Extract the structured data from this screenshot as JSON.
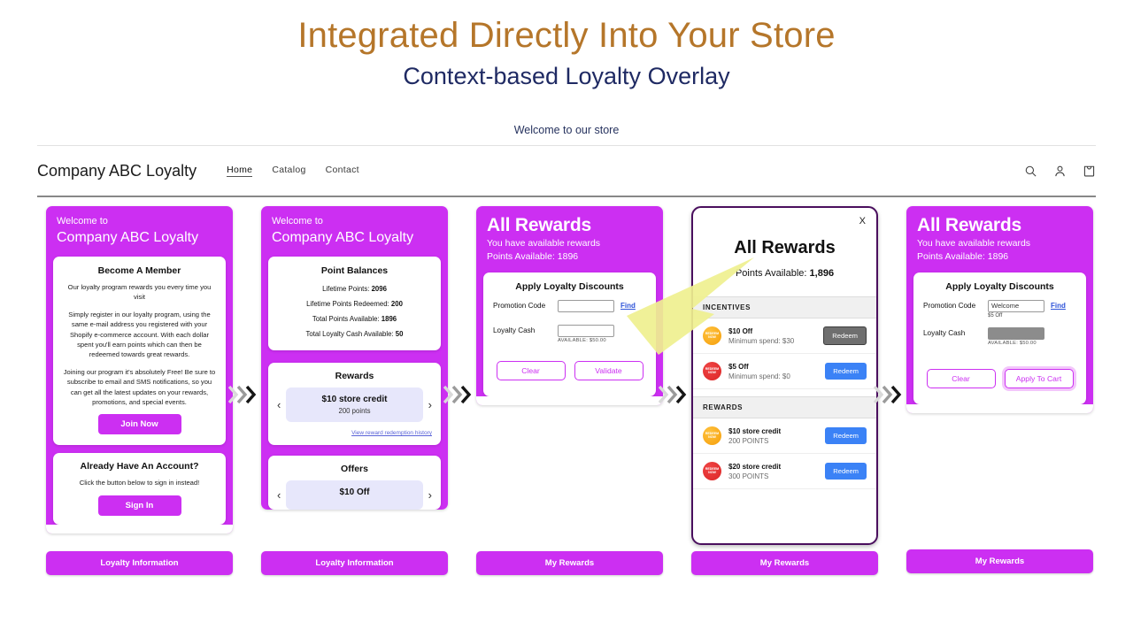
{
  "hero": {
    "title": "Integrated Directly Into Your Store",
    "subtitle": "Context-based Loyalty Overlay",
    "title_color": "#b5762a",
    "subtitle_color": "#1f2a63"
  },
  "store": {
    "announcement": "Welcome to our store",
    "name": "Company ABC Loyalty",
    "nav": [
      {
        "label": "Home",
        "active": true
      },
      {
        "label": "Catalog",
        "active": false
      },
      {
        "label": "Contact",
        "active": false
      }
    ],
    "icons": [
      "search-icon",
      "account-icon",
      "cart-icon"
    ]
  },
  "theme": {
    "magenta": "#cc2ff2",
    "blue": "#3b82f6",
    "grey_button": "#6f6f6f",
    "modal_border": "#4a0f5e",
    "highlight_yellow": "#eff08f"
  },
  "panels": [
    {
      "id": "join",
      "header": {
        "line1": "Welcome to",
        "line2": "Company ABC Loyalty"
      },
      "become": {
        "title": "Become A Member",
        "p1": "Our loyalty program rewards you every time you visit",
        "p2": "Simply register in our loyalty program, using the same e-mail address you registered with your Shopify e-commerce account. With each dollar spent you'll earn points which can then be redeemed towards great rewards.",
        "p3": "Joining our program it's absolutely Free! Be sure to subscribe to email and SMS notifications, so you can get all the latest updates on your rewards, promotions, and special events.",
        "cta": "Join Now"
      },
      "account": {
        "title": "Already Have An Account?",
        "p": "Click the button below to sign in instead!",
        "cta": "Sign In"
      },
      "bottom_bar": "Loyalty Information"
    },
    {
      "id": "balances",
      "header": {
        "line1": "Welcome to",
        "line2": "Company ABC Loyalty"
      },
      "balances": {
        "title": "Point Balances",
        "rows": [
          {
            "label": "Lifetime Points:",
            "value": "2096"
          },
          {
            "label": "Lifetime Points Redeemed:",
            "value": "200"
          },
          {
            "label": "Total Points Available:",
            "value": "1896"
          },
          {
            "label": "Total Loyalty Cash Available:",
            "value": "50"
          }
        ]
      },
      "rewards": {
        "title": "Rewards",
        "item_title": "$10 store credit",
        "item_sub": "200 points",
        "prev_icon": "chevron-left-icon",
        "next_icon": "chevron-right-icon",
        "history_link": "View reward redemption history"
      },
      "offers": {
        "title": "Offers",
        "item_title": "$10 Off"
      },
      "bottom_bar": "Loyalty Information"
    },
    {
      "id": "discounts-empty",
      "header": {
        "big": "All Rewards",
        "line1": "You have available rewards",
        "line2": "Points Available: 1896"
      },
      "form": {
        "title": "Apply Loyalty Discounts",
        "promo_label": "Promotion Code",
        "promo_value": "",
        "find_link": "Find",
        "cash_label": "Loyalty Cash",
        "cash_value": "",
        "cash_note": "AVAILABLE: $50.00",
        "btn_clear": "Clear",
        "btn_action": "Validate"
      },
      "bottom_bar": "My Rewards"
    },
    {
      "id": "all-rewards-modal",
      "close_label": "X",
      "title": "All Rewards",
      "points_label": "Points Available:",
      "points_value": "1,896",
      "sections": [
        {
          "name": "INCENTIVES",
          "items": [
            {
              "title": "$10 Off",
              "sub": "Minimum spend: $30",
              "button": "Redeem",
              "button_style": "grey",
              "badge": "orange"
            },
            {
              "title": "$5 Off",
              "sub": "Minimum spend: $0",
              "button": "Redeem",
              "button_style": "blue",
              "badge": "red"
            }
          ]
        },
        {
          "name": "REWARDS",
          "items": [
            {
              "title": "$10 store credit",
              "sub": "200 POINTS",
              "button": "Redeem",
              "button_style": "blue",
              "badge": "orange"
            },
            {
              "title": "$20 store credit",
              "sub": "300 POINTS",
              "button": "Redeem",
              "button_style": "blue",
              "badge": "red"
            }
          ]
        }
      ],
      "badge_text": "REDEEM NOW",
      "bottom_bar": "My Rewards"
    },
    {
      "id": "discounts-filled",
      "header": {
        "big": "All Rewards",
        "line1": "You have available rewards",
        "line2": "Points Available: 1896"
      },
      "form": {
        "title": "Apply Loyalty Discounts",
        "promo_label": "Promotion Code",
        "promo_value": "Welcome",
        "promo_note": "$5 Off",
        "find_link": "Find",
        "cash_label": "Loyalty Cash",
        "cash_value": "",
        "cash_note": "AVAILABLE: $50.00",
        "btn_clear": "Clear",
        "btn_action": "Apply To Cart"
      },
      "bottom_bar": "My Rewards"
    }
  ]
}
